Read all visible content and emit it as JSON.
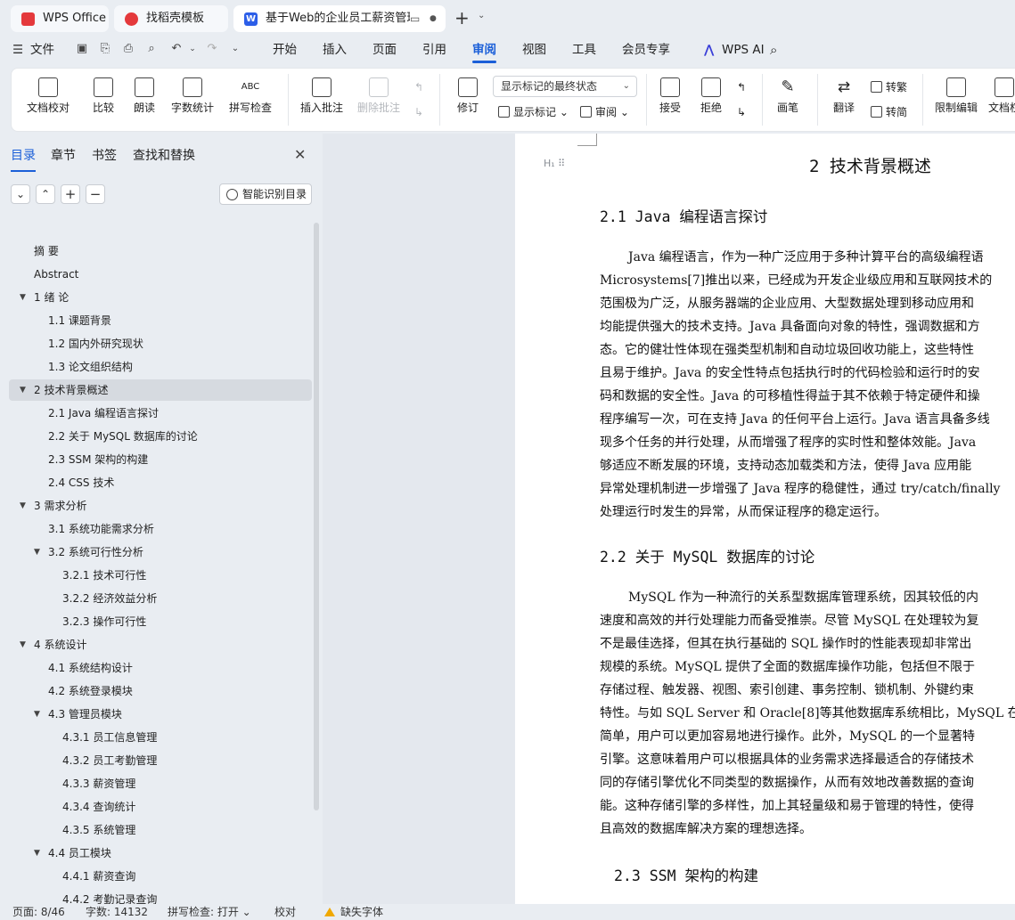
{
  "tabs": [
    {
      "label": "WPS Office"
    },
    {
      "label": "找稻壳模板"
    },
    {
      "label": "基于Web的企业员工薪资管理"
    }
  ],
  "menu": {
    "file": "文件",
    "items": [
      "开始",
      "插入",
      "页面",
      "引用",
      "审阅",
      "视图",
      "工具",
      "会员专享"
    ],
    "ai": "WPS AI"
  },
  "ribbon": {
    "doc_check": "文档校对",
    "compare": "比较",
    "read_aloud": "朗读",
    "word_count": "字数统计",
    "spell_check": "拼写检查",
    "insert_comment": "插入批注",
    "delete_comment": "删除批注",
    "revise": "修订",
    "markup_state": "显示标记的最终状态",
    "show_markup": "显示标记",
    "review": "审阅",
    "accept": "接受",
    "reject": "拒绝",
    "pen": "画笔",
    "translate": "翻译",
    "to_trad": "转繁",
    "to_simp": "转简",
    "restrict_edit": "限制编辑",
    "doc_permission": "文档权"
  },
  "panel": {
    "tabs": [
      "目录",
      "章节",
      "书签",
      "查找和替换"
    ],
    "smart_toc": "智能识别目录",
    "toc": [
      {
        "label": "摘  要",
        "level": 1
      },
      {
        "label": "Abstract",
        "level": 1
      },
      {
        "label": "1 绪 论",
        "level": 1,
        "arrow": "▼"
      },
      {
        "label": "1.1 课题背景",
        "level": 2
      },
      {
        "label": "1.2 国内外研究现状",
        "level": 2
      },
      {
        "label": "1.3 论文组织结构",
        "level": 2
      },
      {
        "label": "2 技术背景概述",
        "level": 1,
        "arrow": "▼",
        "selected": true
      },
      {
        "label": "2.1 Java 编程语言探讨",
        "level": 2
      },
      {
        "label": "2.2  关于 MySQL 数据库的讨论",
        "level": 2
      },
      {
        "label": "2.3 SSM 架构的构建",
        "level": 2
      },
      {
        "label": "2.4 CSS 技术",
        "level": 2
      },
      {
        "label": "3 需求分析",
        "level": 1,
        "arrow": "▼"
      },
      {
        "label": "3.1  系统功能需求分析",
        "level": 2
      },
      {
        "label": "3.2  系统可行性分析",
        "level": 2,
        "arrow": "▼"
      },
      {
        "label": "3.2.1 技术可行性",
        "level": 3
      },
      {
        "label": "3.2.2  经济效益分析",
        "level": 3
      },
      {
        "label": "3.2.3 操作可行性",
        "level": 3
      },
      {
        "label": "4 系统设计",
        "level": 1,
        "arrow": "▼"
      },
      {
        "label": "4.1  系统结构设计",
        "level": 2
      },
      {
        "label": "4.2  系统登录模块",
        "level": 2
      },
      {
        "label": "4.3  管理员模块",
        "level": 2,
        "arrow": "▼"
      },
      {
        "label": "4.3.1  员工信息管理",
        "level": 3
      },
      {
        "label": "4.3.2  员工考勤管理",
        "level": 3
      },
      {
        "label": "4.3.3  薪资管理",
        "level": 3
      },
      {
        "label": "4.3.4  查询统计",
        "level": 3
      },
      {
        "label": "4.3.5  系统管理",
        "level": 3
      },
      {
        "label": "4.4  员工模块",
        "level": 2,
        "arrow": "▼"
      },
      {
        "label": "4.4.1  薪资查询",
        "level": 3
      },
      {
        "label": "4.4.2  考勤记录查询",
        "level": 3
      }
    ]
  },
  "document": {
    "heading1": "2 技术背景概述",
    "h_marker": "H₁",
    "sections": [
      {
        "heading": "2.1 Java 编程语言探讨",
        "lines": [
          "Java 编程语言，作为一种广泛应用于多种计算平台的高级编程语",
          "Microsystems[7]推出以来，已经成为开发企业级应用和互联网技术的",
          "范围极为广泛，从服务器端的企业应用、大型数据处理到移动应用和",
          "均能提供强大的技术支持。Java 具备面向对象的特性，强调数据和方",
          "态。它的健壮性体现在强类型机制和自动垃圾回收功能上，这些特性",
          "且易于维护。Java 的安全性特点包括执行时的代码检验和运行时的安",
          "码和数据的安全性。Java 的可移植性得益于其不依赖于特定硬件和操",
          "程序编写一次，可在支持 Java 的任何平台上运行。Java 语言具备多线",
          "现多个任务的并行处理，从而增强了程序的实时性和整体效能。Java",
          "够适应不断发展的环境，支持动态加载类和方法，使得 Java 应用能",
          "异常处理机制进一步增强了 Java 程序的稳健性，通过 try/catch/finally",
          "处理运行时发生的异常，从而保证程序的稳定运行。"
        ]
      },
      {
        "heading": "2.2 关于 MySQL 数据库的讨论",
        "lines": [
          "MySQL 作为一种流行的关系型数据库管理系统，因其较低的内",
          "速度和高效的并行处理能力而备受推崇。尽管 MySQL 在处理较为复",
          "不是最佳选择，但其在执行基础的 SQL 操作时的性能表现却非常出",
          "规模的系统。MySQL 提供了全面的数据库操作功能，包括但不限于",
          "存储过程、触发器、视图、索引创建、事务控制、锁机制、外键约束",
          "特性。与如 SQL Server 和 Oracle[8]等其他数据库系统相比，MySQL 在",
          "简单，用户可以更加容易地进行操作。此外，MySQL 的一个显著特",
          "引擎。这意味着用户可以根据具体的业务需求选择最适合的存储技术",
          "同的存储引擎优化不同类型的数据操作，从而有效地改善数据的查询",
          "能。这种存储引擎的多样性，加上其轻量级和易于管理的特性，使得",
          "且高效的数据库解决方案的理想选择。"
        ]
      },
      {
        "heading": "2.3 SSM 架构的构建",
        "lines": []
      }
    ]
  },
  "status": {
    "page": "页面: 8/46",
    "words": "字数: 14132",
    "spell": "拼写检查: 打开",
    "proof": "校对",
    "missing_font": "缺失字体"
  },
  "colors": {
    "accent": "#1b5fd8",
    "wps_red": "#e4393c",
    "warning": "#f0a800"
  }
}
